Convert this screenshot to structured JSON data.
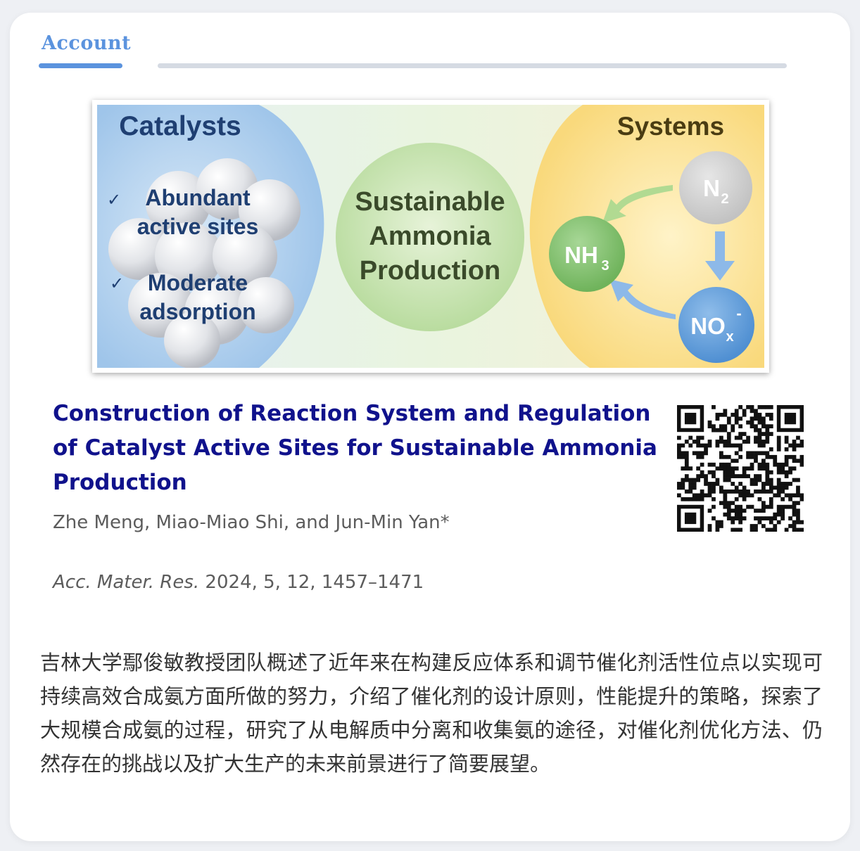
{
  "tab": {
    "label": "Account"
  },
  "toc_graphic": {
    "catalysts": {
      "heading": "Catalysts",
      "bullets": [
        {
          "line1": "Abundant",
          "line2": "active sites"
        },
        {
          "line1": "Moderate",
          "line2": "adsorption"
        }
      ]
    },
    "center": {
      "line1": "Sustainable",
      "line2": "Ammonia",
      "line3": "Production"
    },
    "systems": {
      "heading": "Systems",
      "n2": "N",
      "n2_sub": "2",
      "nh3": "NH",
      "nh3_sub": "3",
      "nox": "NO",
      "nox_sub": "x",
      "nox_sup": "-"
    },
    "colors": {
      "catalysts_blue": "#a9cdee",
      "center_green": "#c8e6b4",
      "systems_yellow": "#fbe39a",
      "heading_navy": "#1f3f72",
      "n2_gray": "#d4d4d4",
      "nh3_green": "#8cc77a",
      "nox_blue": "#6ea7df"
    }
  },
  "article": {
    "title": "Construction of Reaction System and Regulation of Catalyst Active Sites for Sustainable Ammonia Production",
    "authors": "Zhe Meng, Miao-Miao Shi, and Jun-Min Yan*",
    "journal": "Acc. Mater. Res.",
    "citation_rest": " 2024, 5, 12, 1457–1471",
    "abstract": "吉林大学鄢俊敏教授团队概述了近年来在构建反应体系和调节催化剂活性位点以实现可持续高效合成氨方面所做的努力，介绍了催化剂的设计原则，性能提升的策略，探索了大规模合成氨的过程，研究了从电解质中分离和收集氨的途径，对催化剂优化方法、仍然存在的挑战以及扩大生产的未来前景进行了简要展望。"
  }
}
